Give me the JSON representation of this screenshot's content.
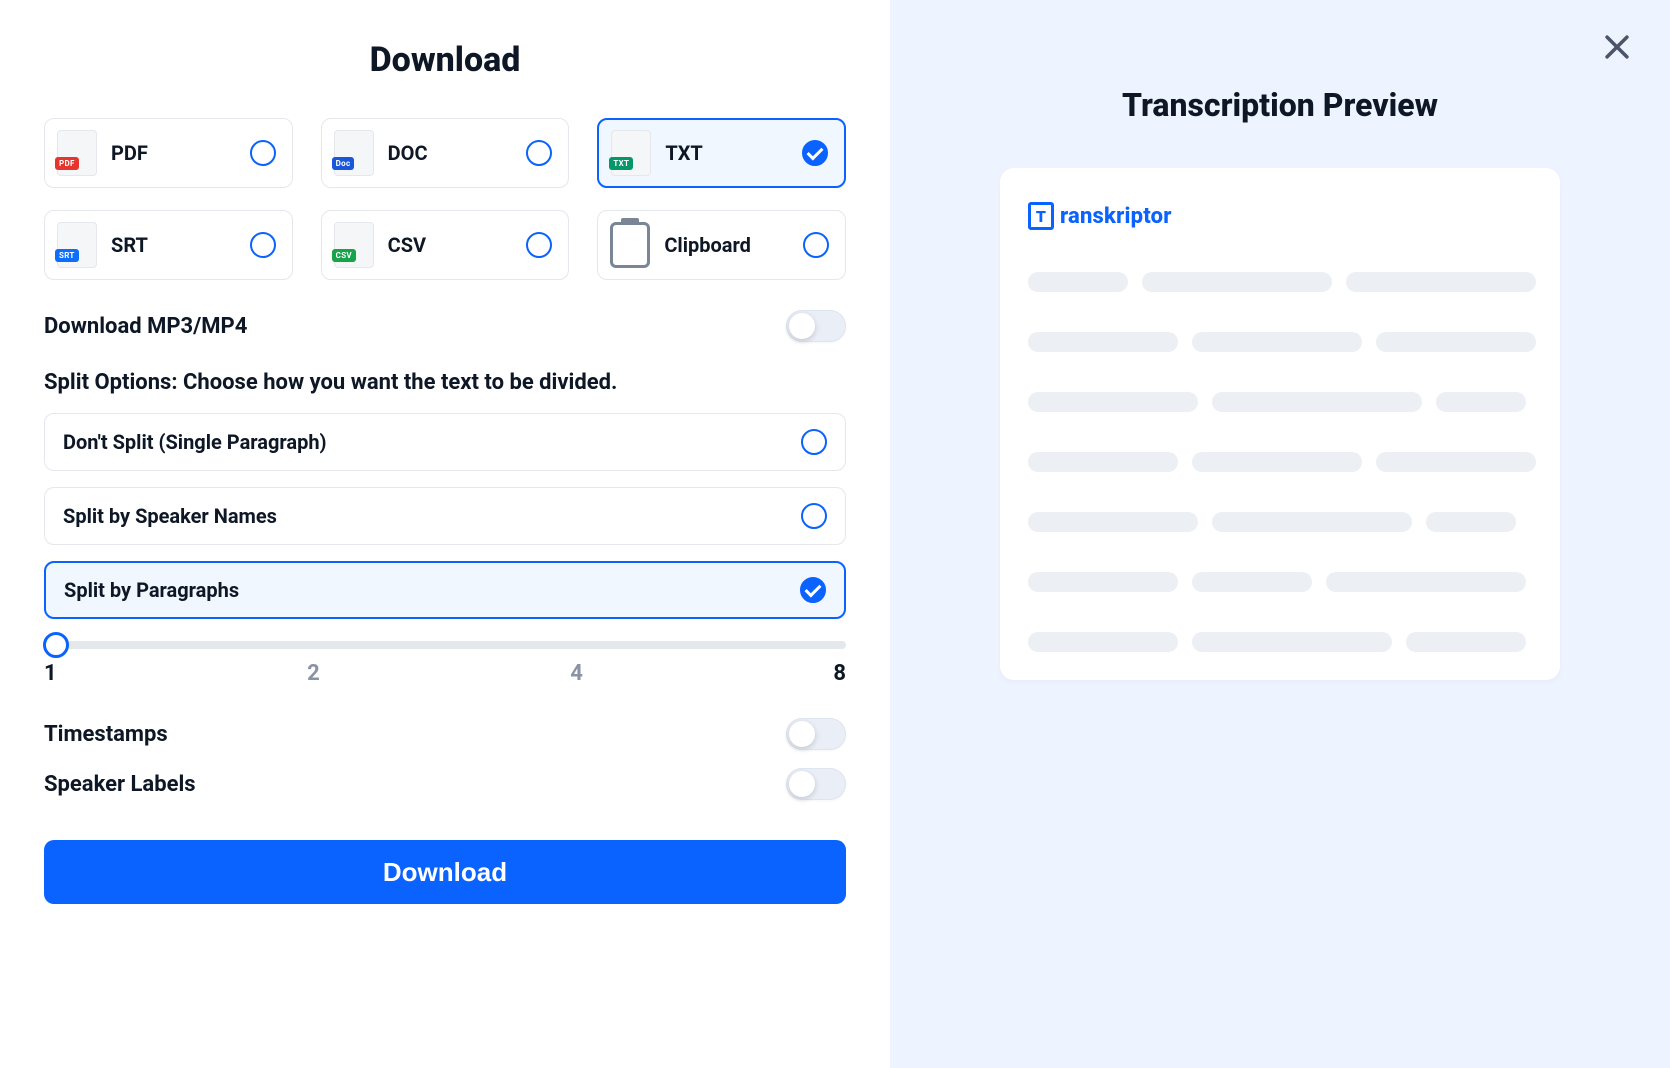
{
  "left": {
    "title": "Download",
    "formats": [
      {
        "id": "pdf",
        "label": "PDF",
        "badge_class": "pdf",
        "selected": false
      },
      {
        "id": "doc",
        "label": "DOC",
        "badge_class": "doc",
        "selected": false
      },
      {
        "id": "txt",
        "label": "TXT",
        "badge_class": "txt",
        "selected": true
      },
      {
        "id": "srt",
        "label": "SRT",
        "badge_class": "srt",
        "selected": false
      },
      {
        "id": "csv",
        "label": "CSV",
        "badge_class": "csv",
        "selected": false
      },
      {
        "id": "clipboard",
        "label": "Clipboard",
        "is_clipboard": true,
        "selected": false
      }
    ],
    "mp3_toggle_label": "Download MP3/MP4",
    "mp3_toggle_on": false,
    "split_label": "Split Options: Choose how you want the text to be divided.",
    "split_options": [
      {
        "label": "Don't Split (Single Paragraph)",
        "selected": false
      },
      {
        "label": "Split by Speaker Names",
        "selected": false
      },
      {
        "label": "Split by Paragraphs",
        "selected": true
      }
    ],
    "slider": {
      "value": 1,
      "ticks": [
        "1",
        "2",
        "4",
        "8"
      ]
    },
    "timestamps_label": "Timestamps",
    "timestamps_on": false,
    "speakerlabels_label": "Speaker Labels",
    "speakerlabels_on": false,
    "download_button": "Download"
  },
  "right": {
    "title": "Transcription Preview",
    "brand": "ranskriptor",
    "brand_letter": "T"
  }
}
